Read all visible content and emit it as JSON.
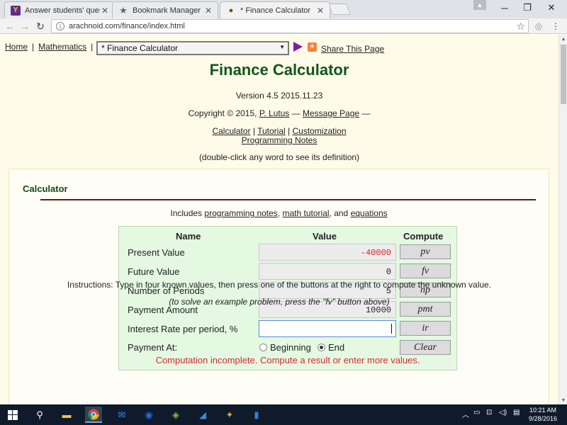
{
  "browser": {
    "tabs": [
      {
        "title": "Answer students' questio",
        "favicon": "yahoo-answers-icon",
        "active": false
      },
      {
        "title": "Bookmark Manager",
        "favicon": "star-icon",
        "active": false
      },
      {
        "title": "* Finance Calculator",
        "favicon": "arachnoid-icon",
        "active": true
      }
    ],
    "url": "arachnoid.com/finance/index.html"
  },
  "nav": {
    "home": "Home",
    "separator": "|",
    "mathematics": "Mathematics",
    "select_value": "* Finance Calculator",
    "share": "Share This Page"
  },
  "header": {
    "title": "Finance Calculator",
    "version": "Version 4.5 2015.11.23",
    "copyright_prefix": "Copyright © 2015,",
    "author": "P. Lutus",
    "dash": "—",
    "message_page": "Message Page",
    "dash_end": "—",
    "links": {
      "calculator": "Calculator",
      "tutorial": "Tutorial",
      "customization": "Customization",
      "programming_notes": "Programming Notes"
    },
    "bar": "|",
    "hint": "(double-click any word to see its definition)"
  },
  "calculator_section": {
    "title": "Calculator",
    "includes_prefix": "Includes",
    "link_programming": "programming notes",
    "comma": ",",
    "link_tutorial": "math tutorial",
    "and_text": ", and",
    "link_equations": "equations",
    "headers": {
      "name": "Name",
      "value": "Value",
      "compute": "Compute"
    },
    "rows": [
      {
        "label": "Present Value",
        "value": "-40000",
        "button": "pv"
      },
      {
        "label": "Future Value",
        "value": "0",
        "button": "fv"
      },
      {
        "label": "Number of Periods",
        "value": "5",
        "button": "np"
      },
      {
        "label": "Payment Amount",
        "value": "10000",
        "button": "pmt"
      },
      {
        "label": "Interest Rate per period, %",
        "value": "",
        "button": "ir"
      }
    ],
    "payment_at_label": "Payment At:",
    "radio_beginning": "Beginning",
    "radio_end": "End",
    "radio_selected": "End",
    "clear_button": "Clear",
    "status": "Computation incomplete. Compute a result or enter more values.",
    "colors": {
      "negative": "#e02020",
      "status": "#d62c2c",
      "panel": "#e4f8e2"
    }
  },
  "instructions": "Instructions: Type in four known values, then press one of the buttons at the right to compute the unknown value.",
  "example_note": "(to solve an example problem, press the \"fv\" button above)",
  "taskbar": {
    "time": "10:21 AM",
    "date": "9/28/2016"
  }
}
